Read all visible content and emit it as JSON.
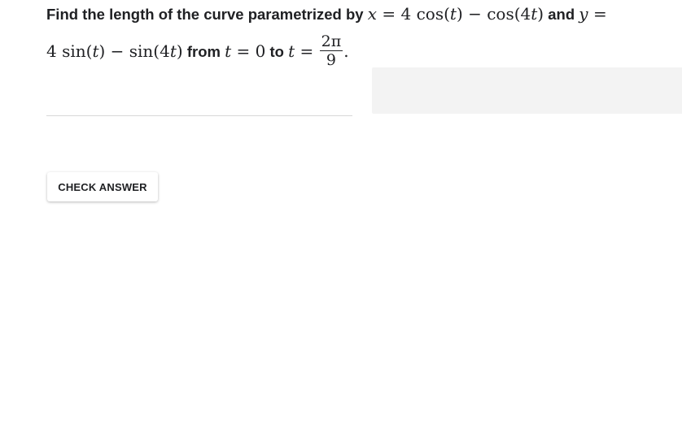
{
  "question": {
    "line1": {
      "prefix": "Find the length of the curve parametrized by ",
      "x_var": "x",
      "eq1": " = 4 cos(",
      "t1": "t",
      "mid1": ") − cos(4",
      "t2": "t",
      "close1": ")",
      "and_text": " and ",
      "y_var": "y",
      "eq2": " ="
    },
    "line2": {
      "expr_a": "4 sin(",
      "t3": "t",
      "expr_b": ") − sin(4",
      "t4": "t",
      "expr_c": ")",
      "from_text": " from ",
      "t5": "t",
      "eq3": " = 0",
      "to_text": " to ",
      "t6": "t",
      "eq4": " = ",
      "frac_num": "2π",
      "frac_den": "9",
      "end": "."
    }
  },
  "answer": {
    "value": ""
  },
  "check_button": {
    "label": "CHECK ANSWER"
  }
}
